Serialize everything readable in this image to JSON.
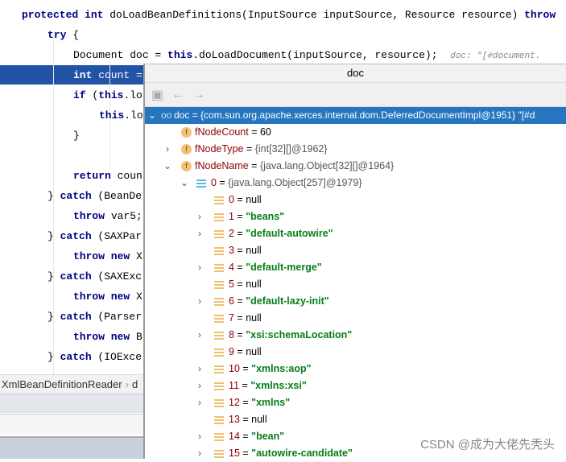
{
  "code": {
    "l1": [
      "protected int ",
      "doLoadBeanDefinitions(InputSource inputSource, Resource resource) ",
      "throw"
    ],
    "l2": [
      "try",
      " {"
    ],
    "l3": [
      "Document doc = ",
      "this",
      ".doLoadDocument(inputSource, resource);  ",
      "doc: \"[#document."
    ],
    "l4": [
      "int",
      " count ="
    ],
    "l5": [
      "if",
      " (",
      "this",
      ".lo"
    ],
    "l6": [
      "this",
      ".lo"
    ],
    "l7": "}",
    "l8": [
      "return",
      " coun"
    ],
    "l9": [
      "} ",
      "catch",
      " (BeanDe"
    ],
    "l10": [
      "throw",
      " var5;"
    ],
    "l11": [
      "} ",
      "catch",
      " (SAXPar"
    ],
    "l12": [
      "throw new",
      " X"
    ],
    "l13": [
      "} ",
      "catch",
      " (SAXExc"
    ],
    "l14": [
      "throw new",
      " X"
    ],
    "l15": [
      "} ",
      "catch",
      " (Parser"
    ],
    "l16": [
      "throw new",
      " B"
    ],
    "l17": [
      "} ",
      "catch",
      " (IOExce"
    ]
  },
  "breadcrumb": [
    "XmlBeanDefinitionReader",
    "d"
  ],
  "popup": {
    "title": "doc",
    "root": {
      "name": "doc",
      "value": "= {com.sun.org.apache.xerces.internal.dom.DeferredDocumentImpl@1951} \"[#d"
    },
    "fields": [
      {
        "name": "fNodeCount",
        "value": "= 60"
      },
      {
        "name": "fNodeType",
        "value": "{int[32][]@1962}"
      },
      {
        "name": "fNodeName",
        "value": "{java.lang.Object[32][]@1964}"
      }
    ],
    "sub": {
      "name": "0",
      "value": "{java.lang.Object[257]@1979}"
    },
    "items": [
      {
        "i": "0",
        "v": "null",
        "str": false,
        "exp": false
      },
      {
        "i": "1",
        "v": "\"beans\"",
        "str": true,
        "exp": true
      },
      {
        "i": "2",
        "v": "\"default-autowire\"",
        "str": true,
        "exp": true
      },
      {
        "i": "3",
        "v": "null",
        "str": false,
        "exp": false
      },
      {
        "i": "4",
        "v": "\"default-merge\"",
        "str": true,
        "exp": true
      },
      {
        "i": "5",
        "v": "null",
        "str": false,
        "exp": false
      },
      {
        "i": "6",
        "v": "\"default-lazy-init\"",
        "str": true,
        "exp": true
      },
      {
        "i": "7",
        "v": "null",
        "str": false,
        "exp": false
      },
      {
        "i": "8",
        "v": "\"xsi:schemaLocation\"",
        "str": true,
        "exp": true
      },
      {
        "i": "9",
        "v": "null",
        "str": false,
        "exp": false
      },
      {
        "i": "10",
        "v": "\"xmlns:aop\"",
        "str": true,
        "exp": true
      },
      {
        "i": "11",
        "v": "\"xmlns:xsi\"",
        "str": true,
        "exp": true
      },
      {
        "i": "12",
        "v": "\"xmlns\"",
        "str": true,
        "exp": true
      },
      {
        "i": "13",
        "v": "null",
        "str": false,
        "exp": false
      },
      {
        "i": "14",
        "v": "\"bean\"",
        "str": true,
        "exp": true
      },
      {
        "i": "15",
        "v": "\"autowire-candidate\"",
        "str": true,
        "exp": true
      }
    ]
  },
  "watermark": "CSDN @成为大佬先秃头"
}
